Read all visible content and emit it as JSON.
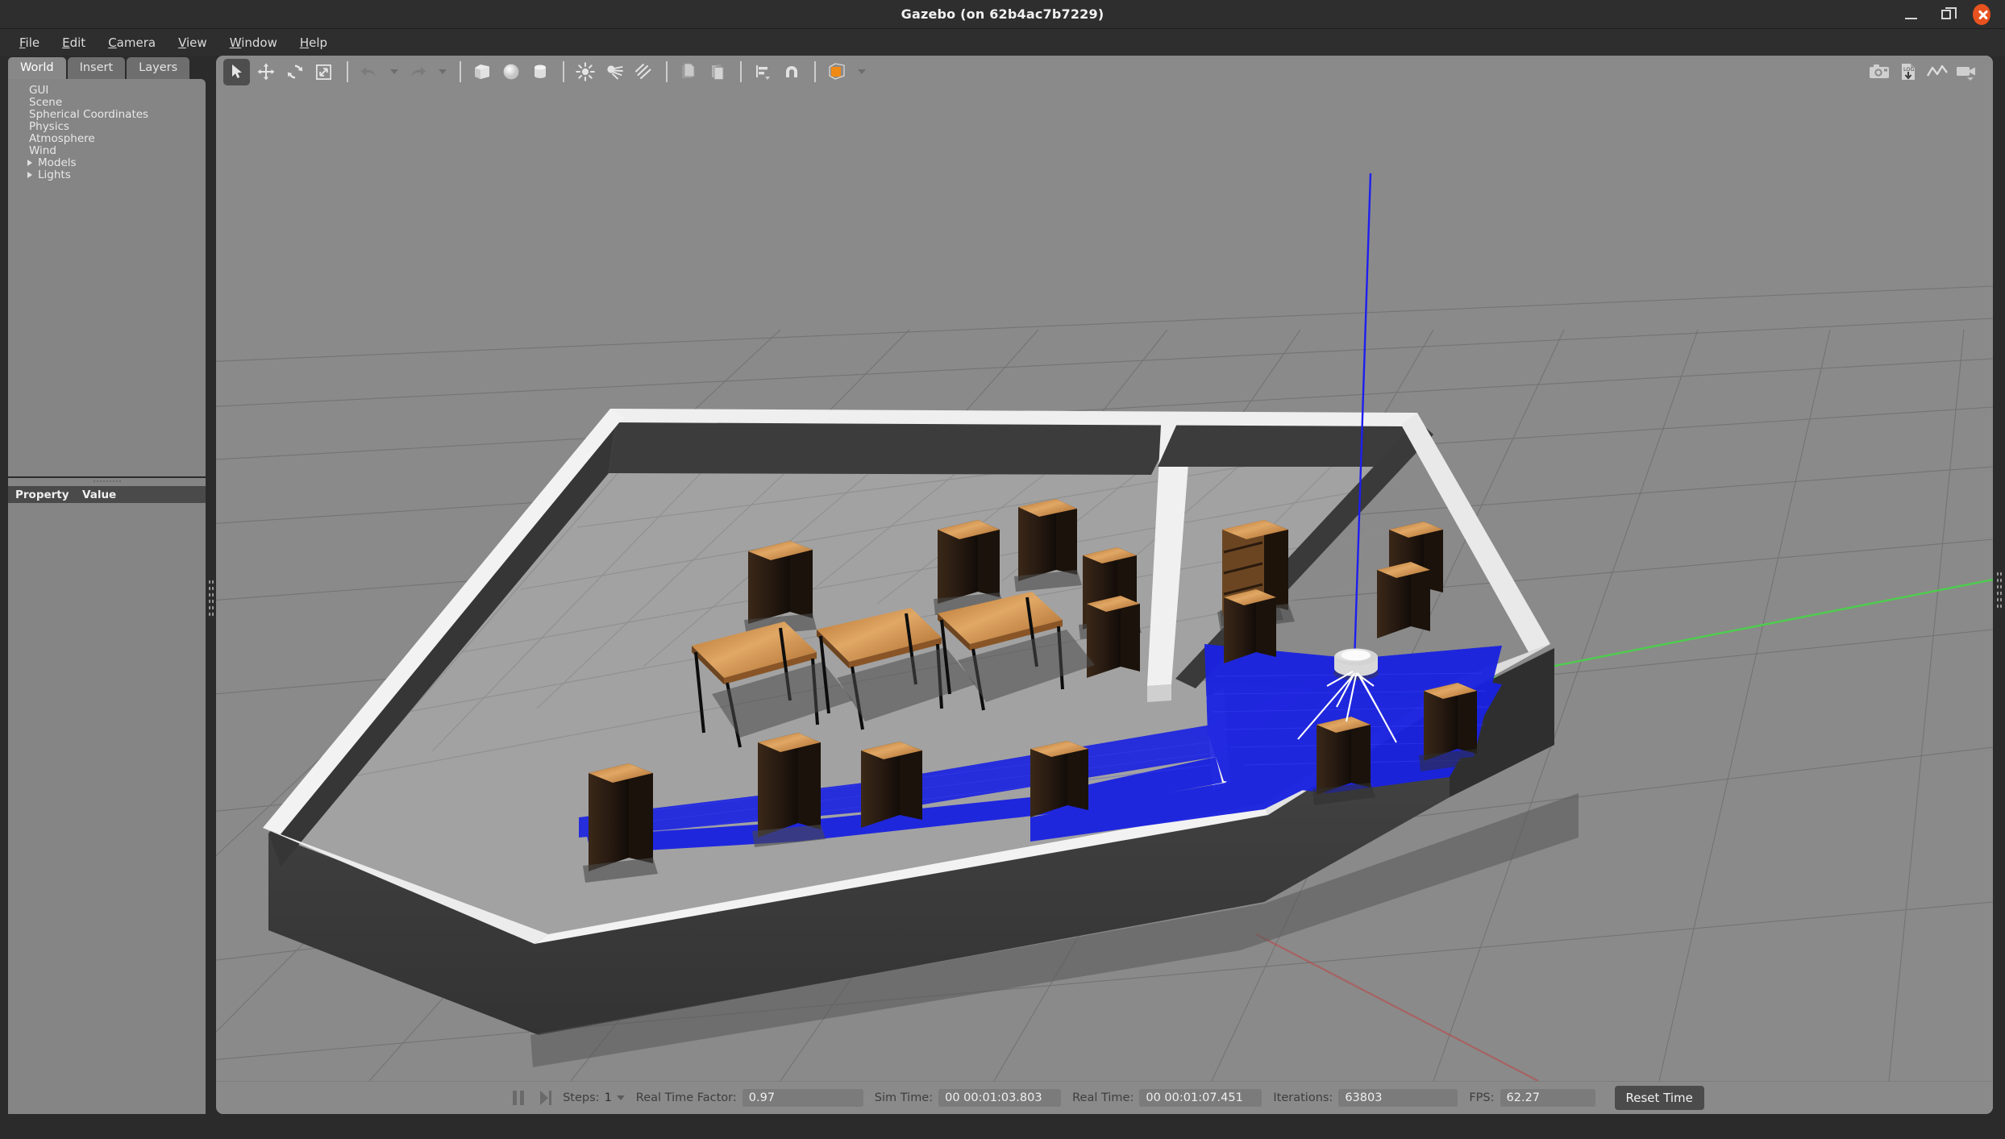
{
  "window": {
    "title": "Gazebo (on 62b4ac7b7229)",
    "minimize_label": "Minimize",
    "maximize_label": "Restore",
    "close_label": "Close"
  },
  "menubar": {
    "items": [
      {
        "label": "File",
        "mnemonic": "F"
      },
      {
        "label": "Edit",
        "mnemonic": "E"
      },
      {
        "label": "Camera",
        "mnemonic": "C"
      },
      {
        "label": "View",
        "mnemonic": "V"
      },
      {
        "label": "Window",
        "mnemonic": "W"
      },
      {
        "label": "Help",
        "mnemonic": "H"
      }
    ]
  },
  "left_panel": {
    "tabs": [
      {
        "label": "World",
        "active": true
      },
      {
        "label": "Insert",
        "active": false
      },
      {
        "label": "Layers",
        "active": false
      }
    ],
    "tree": [
      {
        "label": "GUI",
        "expandable": false
      },
      {
        "label": "Scene",
        "expandable": false
      },
      {
        "label": "Spherical Coordinates",
        "expandable": false
      },
      {
        "label": "Physics",
        "expandable": false
      },
      {
        "label": "Atmosphere",
        "expandable": false
      },
      {
        "label": "Wind",
        "expandable": false
      },
      {
        "label": "Models",
        "expandable": true
      },
      {
        "label": "Lights",
        "expandable": true
      }
    ],
    "property_table": {
      "columns": [
        "Property",
        "Value"
      ],
      "rows": []
    }
  },
  "toolbar": {
    "left_tools": [
      {
        "name": "select-mode",
        "icon": "cursor-arrow-icon",
        "active": true,
        "tooltip": "Selection Mode"
      },
      {
        "name": "translate-mode",
        "icon": "move-arrows-icon",
        "active": false,
        "tooltip": "Translation Mode"
      },
      {
        "name": "rotate-mode",
        "icon": "rotate-icon",
        "active": false,
        "tooltip": "Rotation Mode"
      },
      {
        "name": "scale-mode",
        "icon": "scale-icon",
        "active": false,
        "tooltip": "Scale Mode"
      },
      {
        "name": "undo",
        "icon": "undo-arrow-icon",
        "active": false,
        "disabled": true,
        "tooltip": "Undo"
      },
      {
        "name": "undo-history",
        "icon": "chevron-down-icon",
        "active": false,
        "tooltip": "Undo history"
      },
      {
        "name": "redo",
        "icon": "redo-arrow-icon",
        "active": false,
        "disabled": true,
        "tooltip": "Redo"
      },
      {
        "name": "redo-history",
        "icon": "chevron-down-icon",
        "active": false,
        "tooltip": "Redo history"
      },
      {
        "name": "insert-box",
        "icon": "box-icon",
        "active": false,
        "tooltip": "Box"
      },
      {
        "name": "insert-sphere",
        "icon": "sphere-icon",
        "active": false,
        "tooltip": "Sphere"
      },
      {
        "name": "insert-cylinder",
        "icon": "cylinder-icon",
        "active": false,
        "tooltip": "Cylinder"
      },
      {
        "name": "insert-point-light",
        "icon": "point-light-icon",
        "active": false,
        "tooltip": "Point Light"
      },
      {
        "name": "insert-spot-light",
        "icon": "spot-light-icon",
        "active": false,
        "tooltip": "Spot Light"
      },
      {
        "name": "insert-directional-light",
        "icon": "directional-light-icon",
        "active": false,
        "tooltip": "Directional Light"
      },
      {
        "name": "copy",
        "icon": "copy-icon",
        "active": false,
        "tooltip": "Copy"
      },
      {
        "name": "paste",
        "icon": "paste-icon",
        "active": false,
        "tooltip": "Paste"
      },
      {
        "name": "align",
        "icon": "align-icon",
        "active": false,
        "tooltip": "Align"
      },
      {
        "name": "snap",
        "icon": "magnet-icon",
        "active": false,
        "tooltip": "Snap"
      },
      {
        "name": "view-angle",
        "icon": "orange-cube-icon",
        "active": false,
        "tooltip": "Change view angle"
      }
    ],
    "right_tools": [
      {
        "name": "screenshot",
        "icon": "camera-icon",
        "tooltip": "Take a screenshot"
      },
      {
        "name": "log-record",
        "icon": "log-download-icon",
        "tooltip": "Log data"
      },
      {
        "name": "plot",
        "icon": "plot-line-icon",
        "tooltip": "Open plotting window"
      },
      {
        "name": "video-record",
        "icon": "video-camera-icon",
        "tooltip": "Record a video"
      }
    ]
  },
  "statusbar": {
    "play_pause_icon": "pause-icon",
    "step_icon": "step-forward-icon",
    "steps_label": "Steps:",
    "steps_value": "1",
    "real_time_factor_label": "Real Time Factor:",
    "real_time_factor_value": "0.97",
    "sim_time_label": "Sim Time:",
    "sim_time_value": "00 00:01:03.803",
    "real_time_label": "Real Time:",
    "real_time_value": "00 00:01:07.451",
    "iterations_label": "Iterations:",
    "iterations_value": "63803",
    "fps_label": "FPS:",
    "fps_value": "62.27",
    "reset_time_label": "Reset Time"
  },
  "scene": {
    "description": "Gazebo 3D viewport showing a two-room indoor world with tables, shelves, and a mobile robot emitting blue laser scan rays",
    "colors": {
      "ground": "#8a8a8a",
      "grid_line": "#6f6f6f",
      "floor_inside": "#a2a2a2",
      "wall_outer": "#3c3c3c",
      "wall_top": "#e9e9e9",
      "table_top": "#c07a33",
      "table_leg": "#1a1a1a",
      "shelf_body": "#2a1d14",
      "laser_blue": "#1a22e0",
      "axis_green": "#3fd23f",
      "axis_red": "#c04040",
      "axis_blue": "#2020e0",
      "shadow": "#3b3b3b"
    },
    "robot": {
      "name": "mobile-robot",
      "body_color": "#eeeeee",
      "ray_color": "#ffffff"
    }
  }
}
